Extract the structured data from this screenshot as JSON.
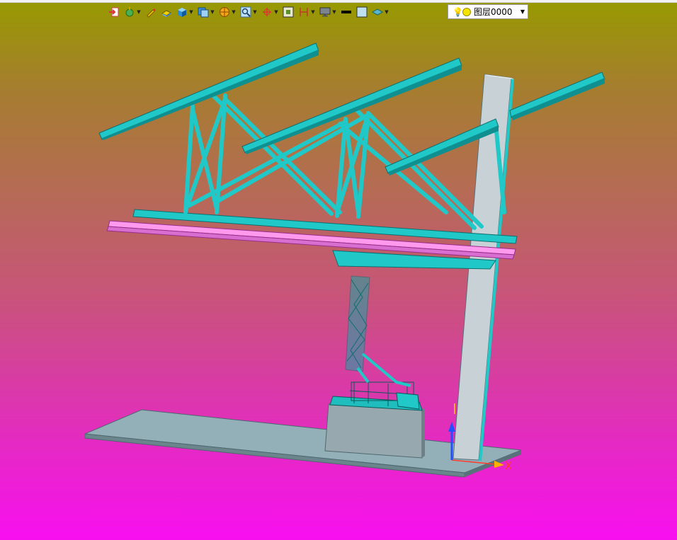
{
  "toolbar": {
    "buttons": [
      {
        "icon": "exit-icon",
        "has_dropdown": false
      },
      {
        "icon": "bulb-settings-icon",
        "has_dropdown": true
      },
      {
        "icon": "pencil-icon",
        "has_dropdown": false
      },
      {
        "icon": "block-icon",
        "has_dropdown": false
      },
      {
        "icon": "solid-box-icon",
        "has_dropdown": true
      },
      {
        "icon": "view-orient-icon",
        "has_dropdown": true
      },
      {
        "icon": "render-sphere-icon",
        "has_dropdown": true
      },
      {
        "icon": "zoom-icon",
        "has_dropdown": true
      },
      {
        "icon": "rotate-icon",
        "has_dropdown": true
      },
      {
        "icon": "fit-view-icon",
        "has_dropdown": false
      },
      {
        "icon": "section-icon",
        "has_dropdown": true
      },
      {
        "icon": "display-monitor-icon",
        "has_dropdown": true
      },
      {
        "icon": "line-weight-icon",
        "has_dropdown": false
      },
      {
        "icon": "color-swatch-icon",
        "has_dropdown": false
      },
      {
        "icon": "layer-stack-icon",
        "has_dropdown": true
      }
    ],
    "colors": {
      "line_weight": "#000000",
      "swatch": "#bfe0ee"
    }
  },
  "layer": {
    "label": "图层0000",
    "bulb_icon": "bulb-icon",
    "state_icon": "layer-on-icon",
    "dropdown_icon": "dropdown-arrow-icon"
  },
  "triad": {
    "x_label": "X",
    "colors": {
      "x": "#ff3a2a",
      "y": "#ffd000",
      "z": "#2050ff"
    }
  },
  "scene": {
    "colors": {
      "steel": "#20c8c8",
      "steel_dark": "#0c6f6f",
      "rail": "#ff99ee",
      "plate": "#8fb0b8",
      "plate_edge": "#56707a",
      "pedestal": "#97a7ae",
      "column": "#c8d2d6"
    }
  }
}
